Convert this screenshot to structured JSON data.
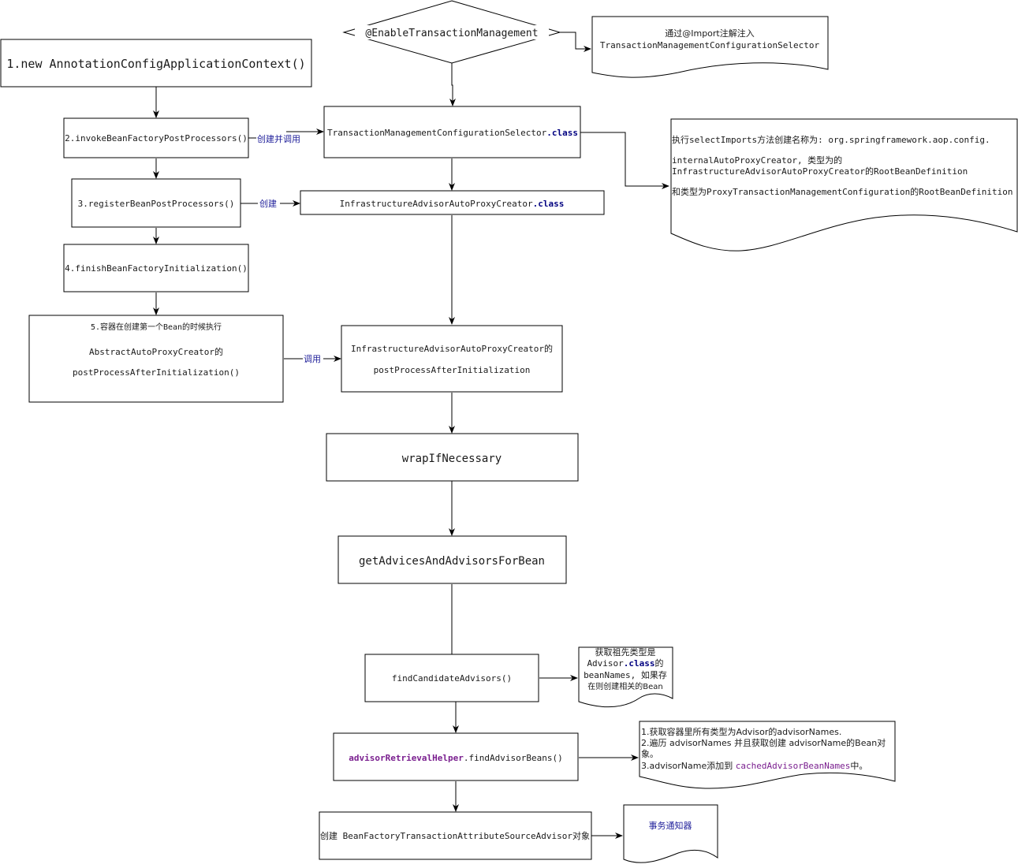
{
  "diagram": {
    "decision": {
      "label": "@EnableTransactionManagement"
    },
    "note_import": {
      "line1": "通过@Import注解注入",
      "line2": "TransactionManagementConfigurationSelector"
    },
    "step1": {
      "label": "1.new AnnotationConfigApplicationContext()"
    },
    "step2": {
      "label": "2.invokeBeanFactoryPostProcessors()"
    },
    "step3": {
      "label": "3.registerBeanPostProcessors()"
    },
    "step4": {
      "label": "4.finishBeanFactoryInitialization()"
    },
    "step5": {
      "line1": "5.容器在创建第一个Bean的时候执行",
      "line2": "AbstractAutoProxyCreator的",
      "line3": "postProcessAfterInitialization()"
    },
    "selector": {
      "name": "TransactionManagementConfigurationSelector",
      "suffix": ".class"
    },
    "creator": {
      "name": "InfrastructureAdvisorAutoProxyCreator",
      "suffix": ".class"
    },
    "post_process": {
      "line1": "InfrastructureAdvisorAutoProxyCreator的",
      "line2": "postProcessAfterInitialization"
    },
    "wrap": {
      "label": "wrapIfNecessary"
    },
    "get_advices": {
      "label": "getAdvicesAndAdvisorsForBean"
    },
    "find_candidates": {
      "label": "findCandidateAdvisors()"
    },
    "find_beans": {
      "object": "advisorRetrievalHelper",
      "method": ".findAdvisorBeans()"
    },
    "create_advisor": {
      "label": "创建 BeanFactoryTransactionAttributeSourceAdvisor对象"
    },
    "note_select_imports": {
      "line1": "执行selectImports方法创建名称为: org.springframework.aop.config.",
      "line2": "internalAutoProxyCreator, 类型为的",
      "line3": "InfrastructureAdvisorAutoProxyCreator的RootBeanDefinition",
      "line4": "和类型为ProxyTransactionManagementConfiguration的RootBeanDefinition"
    },
    "note_ancestor": {
      "line1": "获取祖先类型是",
      "line2a": "Advisor",
      "line2b": ".class",
      "line2c": "的",
      "line3": "beanNames, 如果存",
      "line4": "在则创建相关的Bean"
    },
    "note_advisor_names": {
      "line1": "1.获取容器里所有类型为Advisor的advisorNames.",
      "line2": "2.遍历 advisorNames 并且获取创建 advisorName的Bean对",
      "line3": "象。",
      "line4a": "3.advisorName添加到 ",
      "line4b": "cachedAdvisorBeanNames",
      "line4c": "中。"
    },
    "note_tx_advisor": {
      "label": "事务通知器"
    },
    "edge_labels": {
      "create_and_invoke": "创建并调用",
      "create": "创建",
      "invoke": "调用"
    }
  }
}
